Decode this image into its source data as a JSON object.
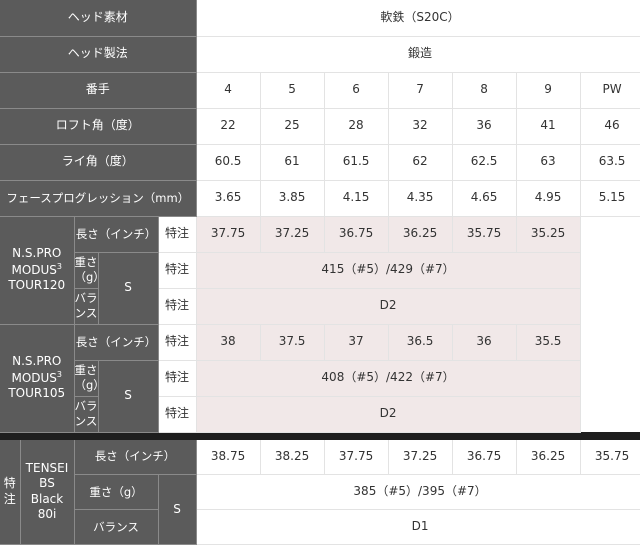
{
  "head_material": {
    "label": "ヘッド素材",
    "value": "軟鉄（S20C）"
  },
  "head_method": {
    "label": "ヘッド製法",
    "value": "鍛造"
  },
  "number": {
    "label": "番手",
    "values": [
      "4",
      "5",
      "6",
      "7",
      "8",
      "9",
      "PW"
    ]
  },
  "loft": {
    "label": "ロフト角（度）",
    "values": [
      "22",
      "25",
      "28",
      "32",
      "36",
      "41",
      "46"
    ]
  },
  "lie": {
    "label": "ライ角（度）",
    "values": [
      "60.5",
      "61",
      "61.5",
      "62",
      "62.5",
      "63",
      "63.5"
    ]
  },
  "face_prog": {
    "label": "フェースプログレッション（mm）",
    "values": [
      "3.65",
      "3.85",
      "4.15",
      "4.35",
      "4.65",
      "4.95",
      "5.15"
    ]
  },
  "shafts": [
    {
      "name_lines": [
        "N.S.PRO",
        "MODUS",
        "TOUR120"
      ],
      "name_sup": "3",
      "flex": "S",
      "length_label": "長さ（インチ）",
      "length_values": [
        "特注",
        "37.75",
        "37.25",
        "36.75",
        "36.25",
        "35.75",
        "35.25"
      ],
      "weight_label": "重さ（g）",
      "weight_custom": "特注",
      "weight_value": "415（#5）/429（#7）",
      "balance_label": "バランス",
      "balance_custom": "特注",
      "balance_value": "D2"
    },
    {
      "name_lines": [
        "N.S.PRO",
        "MODUS",
        "TOUR105"
      ],
      "name_sup": "3",
      "flex": "S",
      "length_label": "長さ（インチ）",
      "length_values": [
        "特注",
        "38",
        "37.5",
        "37",
        "36.5",
        "36",
        "35.5"
      ],
      "weight_label": "重さ（g）",
      "weight_custom": "特注",
      "weight_value": "408（#5）/422（#7）",
      "balance_label": "バランス",
      "balance_custom": "特注",
      "balance_value": "D2"
    },
    {
      "custom_tag": [
        "特",
        "注"
      ],
      "name_lines": [
        "TENSEI",
        "BS",
        "Black",
        "80i"
      ],
      "flex": "S",
      "length_label": "長さ（インチ）",
      "length_values": [
        "38.75",
        "38.25",
        "37.75",
        "37.25",
        "36.75",
        "36.25",
        "35.75"
      ],
      "weight_label": "重さ（g）",
      "weight_value": "385（#5）/395（#7）",
      "balance_label": "バランス",
      "balance_value": "D1"
    }
  ]
}
